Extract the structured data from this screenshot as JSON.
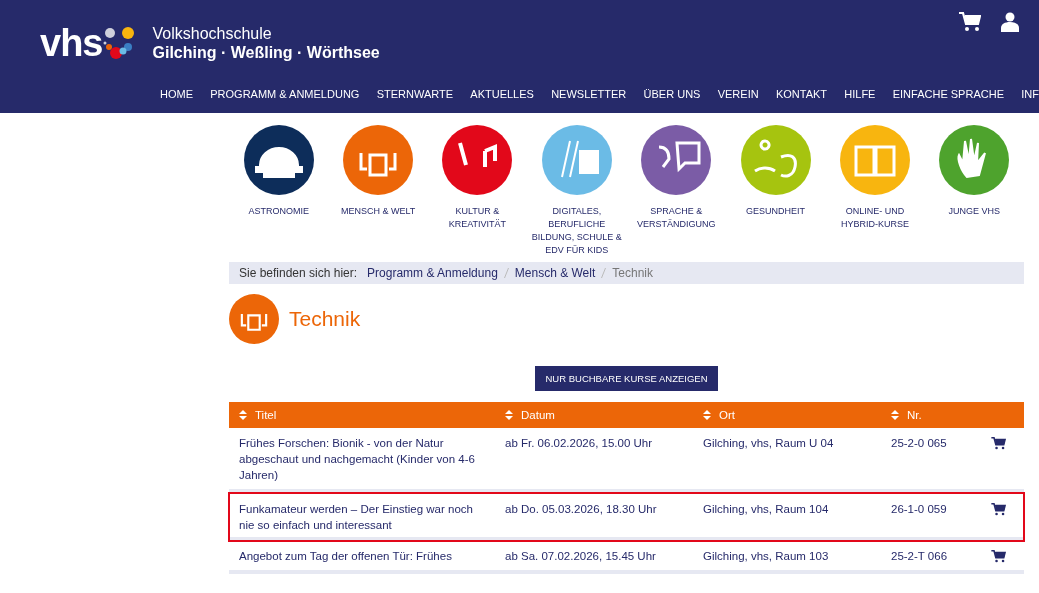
{
  "header": {
    "logo_text": "vhs",
    "org_line1": "Volkshochschule",
    "org_line2": "Gilching · Weßling · Wörthsee"
  },
  "nav": [
    "HOME",
    "PROGRAMM & ANMELDUNG",
    "STERNWARTE",
    "AKTUELLES",
    "NEWSLETTER",
    "ÜBER UNS",
    "VEREIN",
    "KONTAKT",
    "HILFE",
    "EINFACHE SPRACHE",
    "INF"
  ],
  "categories": [
    {
      "label": "ASTRONOMIE",
      "color": "#0d2d5a"
    },
    {
      "label": "MENSCH & WELT",
      "color": "#ec6608"
    },
    {
      "label": "KULTUR & KREATIVITÄT",
      "color": "#e2081a"
    },
    {
      "label": "DIGITALES, BERUFLICHE BILDUNG, SCHULE & EDV FÜR KIDS",
      "color": "#6bbbe6"
    },
    {
      "label": "SPRACHE & VERSTÄNDIGUNG",
      "color": "#7b5ca6"
    },
    {
      "label": "GESUNDHEIT",
      "color": "#a6c40f"
    },
    {
      "label": "ONLINE- UND HYBRID-KURSE",
      "color": "#f8b50f"
    },
    {
      "label": "JUNGE VHS",
      "color": "#4ea32d"
    }
  ],
  "breadcrumb": {
    "prefix": "Sie befinden sich hier:",
    "links": [
      "Programm & Anmeldung",
      "Mensch & Welt"
    ],
    "current": "Technik"
  },
  "page_title": "Technik",
  "filter_button": "NUR BUCHBARE KURSE ANZEIGEN",
  "table": {
    "columns": [
      "Titel",
      "Datum",
      "Ort",
      "Nr."
    ],
    "rows": [
      {
        "title": "Frühes Forschen: Bionik - von der Natur abgeschaut und nachgemacht (Kinder von 4-6 Jahren)",
        "date": "ab Fr. 06.02.2026, 15.00 Uhr",
        "place": "Gilching, vhs, Raum U 04",
        "number": "25-2-0 065",
        "highlighted": false
      },
      {
        "title": "Funkamateur werden – Der Einstieg war noch nie so einfach und interessant",
        "date": "ab Do. 05.03.2026, 18.30 Uhr",
        "place": "Gilching, vhs, Raum 104",
        "number": "26-1-0 059",
        "highlighted": true
      },
      {
        "title": "Angebot zum Tag der offenen Tür: Frühes",
        "date": "ab Sa. 07.02.2026, 15.45 Uhr",
        "place": "Gilching, vhs, Raum 103",
        "number": "25-2-T 066",
        "highlighted": false
      }
    ]
  }
}
